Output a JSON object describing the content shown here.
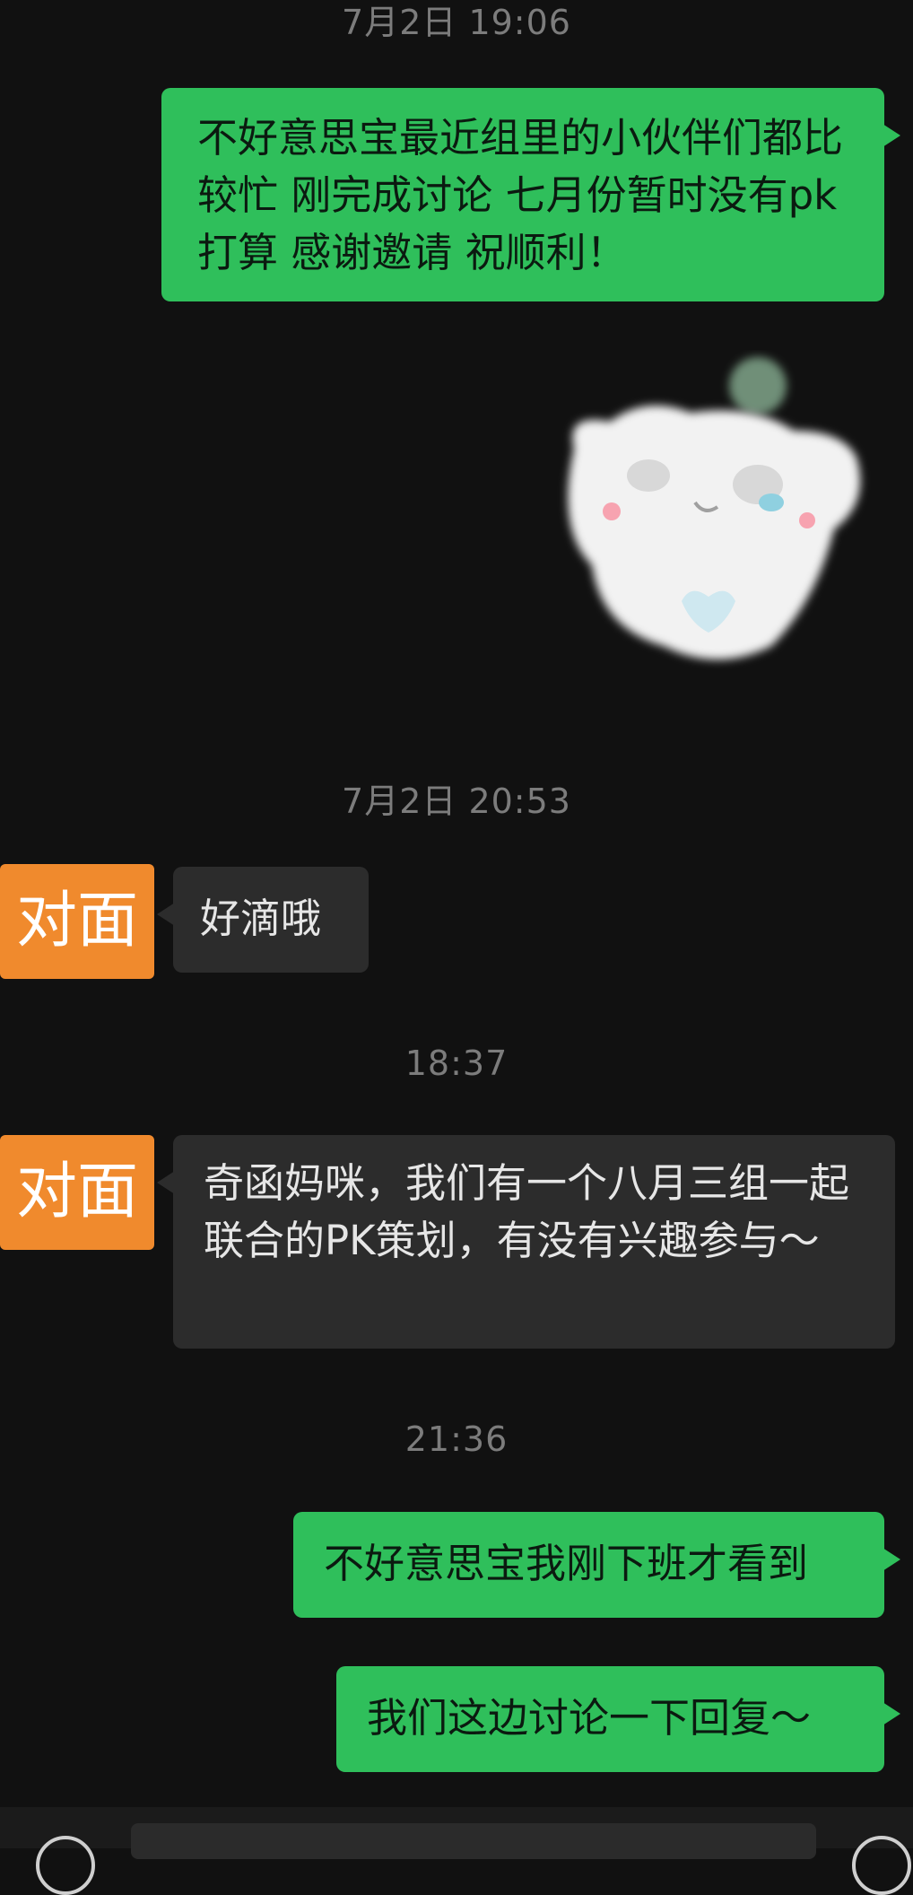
{
  "messages": [
    {
      "kind": "timestamp",
      "text": "7月2日 19:06"
    },
    {
      "kind": "outgoing",
      "text": "不好意思宝最近组里的小伙伴们都比较忙 刚完成讨论 七月份暂时没有pk打算 感谢邀请 祝顺利！"
    },
    {
      "kind": "sticker",
      "icon": "cat-sticker"
    },
    {
      "kind": "timestamp",
      "text": "7月2日 20:53"
    },
    {
      "kind": "incoming",
      "sender": "对面",
      "text": "好滴哦"
    },
    {
      "kind": "timestamp",
      "text": "18:37"
    },
    {
      "kind": "incoming",
      "sender": "对面",
      "text": "奇函妈咪，我们有一个八月三组一起联合的PK策划，有没有兴趣参与～"
    },
    {
      "kind": "timestamp",
      "text": "21:36"
    },
    {
      "kind": "outgoing",
      "text": "不好意思宝我刚下班才看到"
    },
    {
      "kind": "outgoing",
      "text": "我们这边讨论一下回复～"
    }
  ],
  "colors": {
    "background": "#111111",
    "outgoing_bubble": "#2fbf5b",
    "incoming_bubble": "#2c2c2c",
    "avatar_label": "#f08a2d",
    "timestamp": "#7c7c7c"
  },
  "input_bar": {
    "left_icon": "voice-icon",
    "right_icon": "emoji-icon"
  }
}
